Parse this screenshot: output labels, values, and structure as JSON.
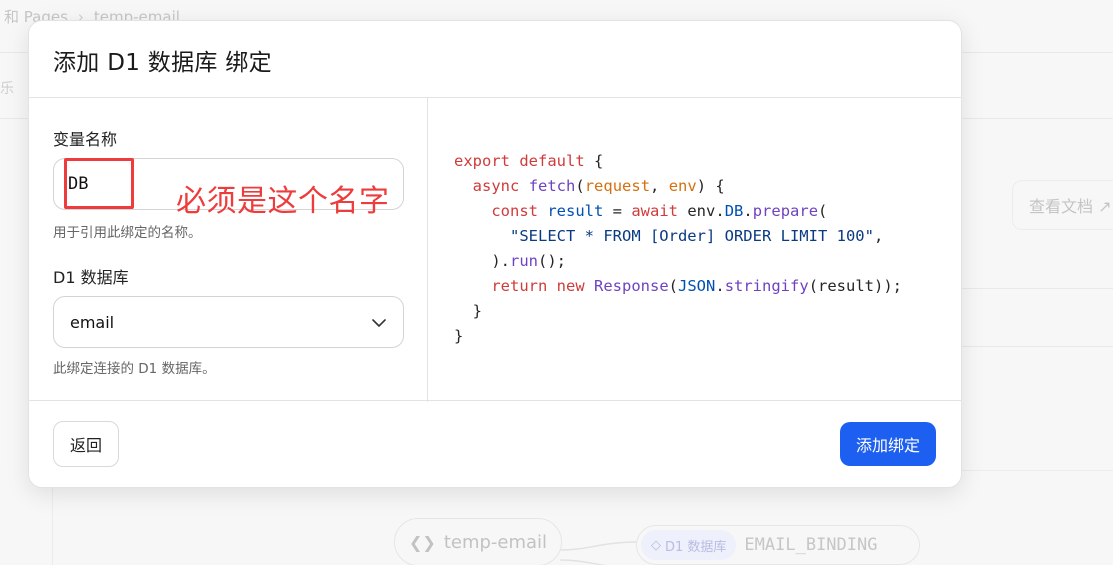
{
  "background": {
    "breadcrumb": {
      "parent": "和 Pages",
      "current": "temp-email"
    },
    "tab_fragment": "乐",
    "docs_link": "查看文档 ↗",
    "worker_node": {
      "label": "temp-email"
    },
    "binding_node": {
      "tag": "D1 数据库",
      "name": "EMAIL_BINDING"
    }
  },
  "modal": {
    "title": "添加 D1 数据库 绑定",
    "variable": {
      "label": "变量名称",
      "value": "DB",
      "help": "用于引用此绑定的名称。"
    },
    "database": {
      "label": "D1 数据库",
      "selected": "email",
      "help": "此绑定连接的 D1 数据库。"
    },
    "code_lines": [
      "export default {",
      "  async fetch(request, env) {",
      "    const result = await env.DB.prepare(",
      "      \"SELECT * FROM [Order] ORDER LIMIT 100\",",
      "    ).run();",
      "    return new Response(JSON.stringify(result));",
      "  }",
      "}"
    ],
    "footer": {
      "back_label": "返回",
      "add_label": "添加绑定"
    }
  },
  "annotation": {
    "text": "必须是这个名字",
    "color": "#ee3b3b"
  },
  "colors": {
    "primary_button": "#1d5ff0",
    "code_keyword": "#d03b3b",
    "code_function": "#6f42c1",
    "code_param": "#d4700f",
    "code_variable": "#0050b3"
  }
}
